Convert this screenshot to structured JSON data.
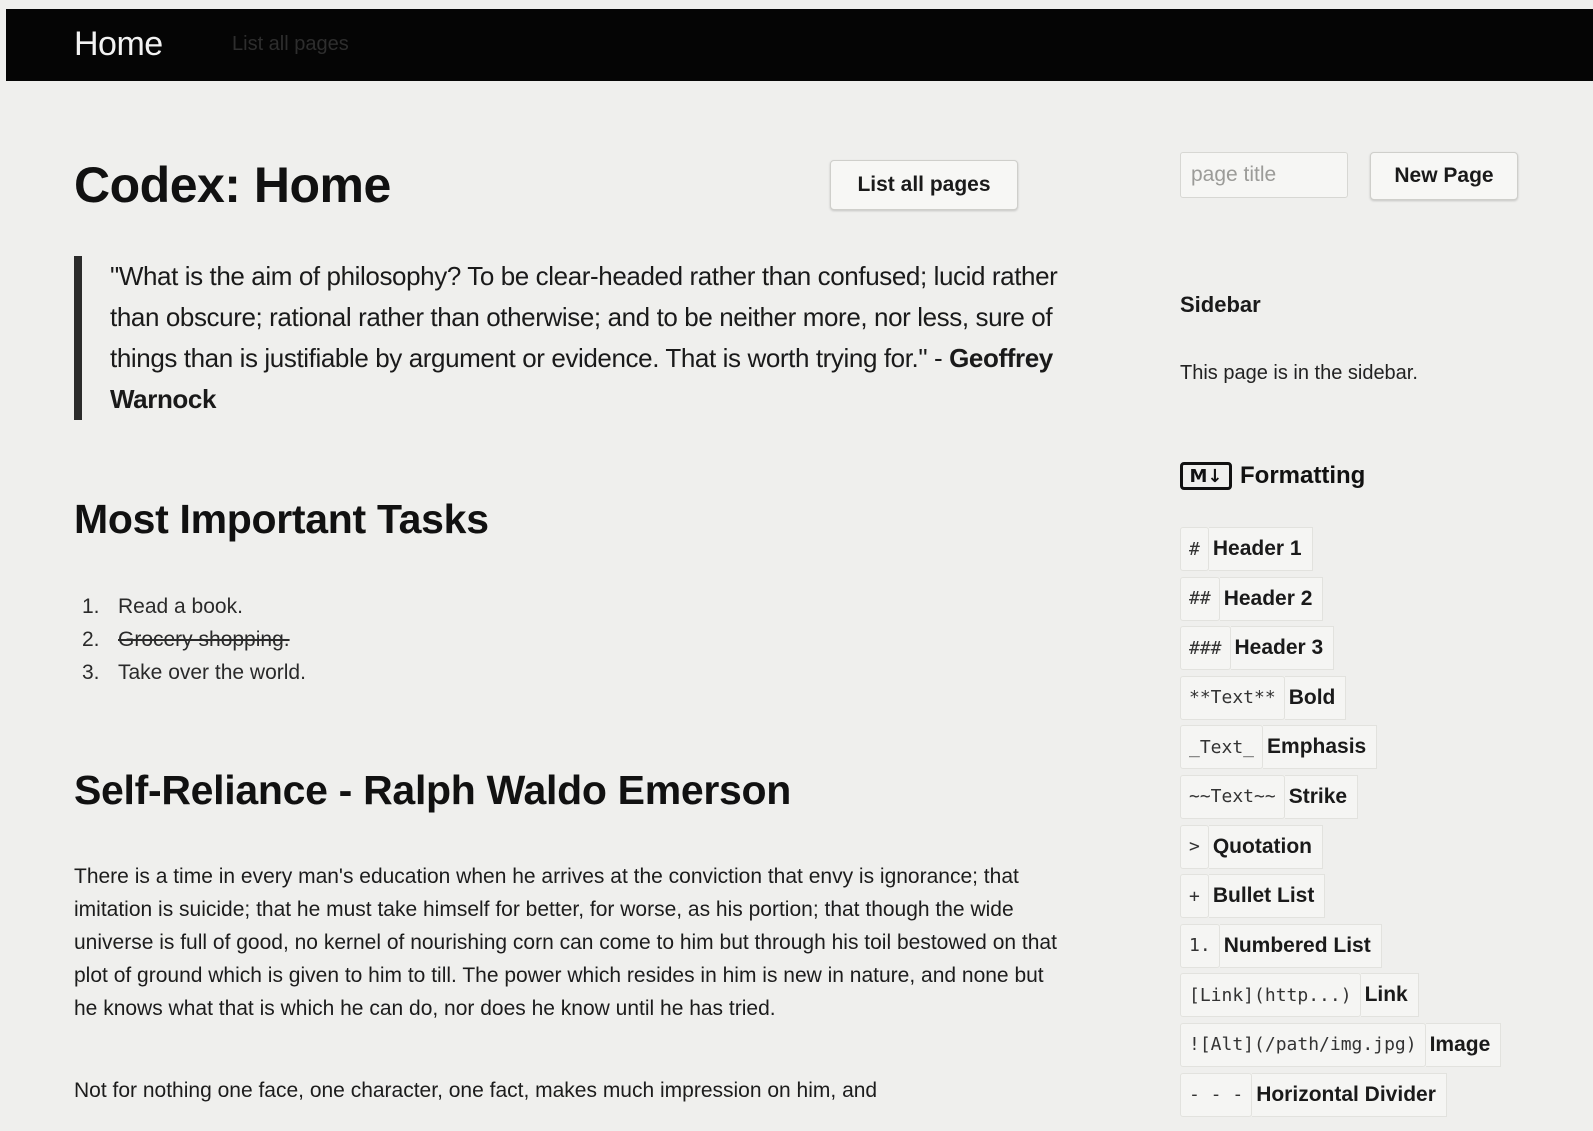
{
  "navbar": {
    "brand": "Home",
    "link": "List all pages"
  },
  "main": {
    "title": "Codex: Home",
    "list_button": "List all pages",
    "quote": {
      "text": "\"What is the aim of philosophy? To be clear-headed rather than confused; lucid rather than obscure; rational rather than otherwise; and to be neither more, nor less, sure of things than is justifiable by argument or evidence. That is worth trying for.\" - ",
      "author": "Geoffrey Warnock"
    },
    "tasks_heading": "Most Important Tasks",
    "tasks": [
      {
        "num": "1.",
        "text": "Read a book.",
        "done": false
      },
      {
        "num": "2.",
        "text": "Grocery shopping.",
        "done": true
      },
      {
        "num": "3.",
        "text": "Take over the world.",
        "done": false
      }
    ],
    "essay_heading": "Self-Reliance - Ralph Waldo Emerson",
    "paragraphs": [
      "There is a time in every man's education when he arrives at the conviction that envy is ignorance; that imitation is suicide; that he must take himself for better, for worse, as his portion; that though the wide universe is full of good, no kernel of nourishing corn can come to him but through his toil bestowed on that plot of ground which is given to him to till. The power which resides in him is new in nature, and none but he knows what that is which he can do, nor does he know until he has tried.",
      "Not for nothing one face, one character, one fact, makes much impression on him, and"
    ]
  },
  "sidebar": {
    "title_placeholder": "page title",
    "new_page_button": "New Page",
    "heading": "Sidebar",
    "text": "This page is in the sidebar.",
    "formatting_heading": "Formatting",
    "formatting_icon": "M↓",
    "formatting": [
      {
        "code": "#",
        "label": "Header 1"
      },
      {
        "code": "##",
        "label": "Header 2"
      },
      {
        "code": "###",
        "label": "Header 3"
      },
      {
        "code": "**Text**",
        "label": "Bold"
      },
      {
        "code": "_Text_",
        "label": "Emphasis"
      },
      {
        "code": "~~Text~~",
        "label": "Strike"
      },
      {
        "code": ">",
        "label": "Quotation"
      },
      {
        "code": "+",
        "label": "Bullet List"
      },
      {
        "code": "1.",
        "label": "Numbered List"
      },
      {
        "code": "[Link](http...)",
        "label": "Link"
      },
      {
        "code": "![Alt](/path/img.jpg)",
        "label": "Image"
      },
      {
        "code": "- - -",
        "label": "Horizontal Divider"
      }
    ]
  }
}
